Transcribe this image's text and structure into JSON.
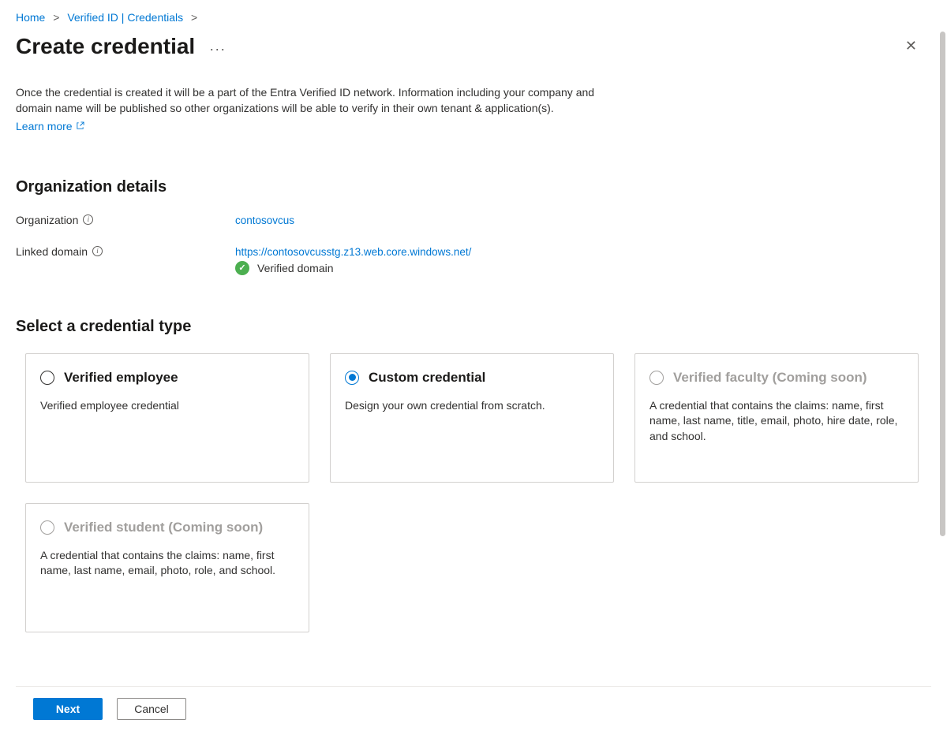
{
  "breadcrumb": {
    "items": [
      {
        "label": "Home"
      },
      {
        "label": "Verified ID | Credentials"
      }
    ]
  },
  "header": {
    "title": "Create credential"
  },
  "intro": {
    "text": "Once the credential is created it will be a part of the Entra Verified ID network. Information including your company and domain name will be published so other organizations will be able to verify in their own tenant & application(s).",
    "learn_more": "Learn more"
  },
  "org_details": {
    "heading": "Organization details",
    "org_label": "Organization",
    "org_value": "contosovcus",
    "domain_label": "Linked domain",
    "domain_value": "https://contosovcusstg.z13.web.core.windows.net/",
    "verified_text": "Verified domain"
  },
  "cred_types": {
    "heading": "Select a credential type",
    "cards": [
      {
        "title": "Verified employee",
        "desc": "Verified employee credential",
        "selected": false,
        "disabled": false
      },
      {
        "title": "Custom credential",
        "desc": "Design your own credential from scratch.",
        "selected": true,
        "disabled": false
      },
      {
        "title": "Verified faculty (Coming soon)",
        "desc": "A credential that contains the claims: name, first name, last name, title, email, photo, hire date, role, and school.",
        "selected": false,
        "disabled": true
      },
      {
        "title": "Verified student (Coming soon)",
        "desc": "A credential that contains the claims: name, first name, last name, email, photo, role, and school.",
        "selected": false,
        "disabled": true
      }
    ]
  },
  "footer": {
    "next": "Next",
    "cancel": "Cancel"
  }
}
